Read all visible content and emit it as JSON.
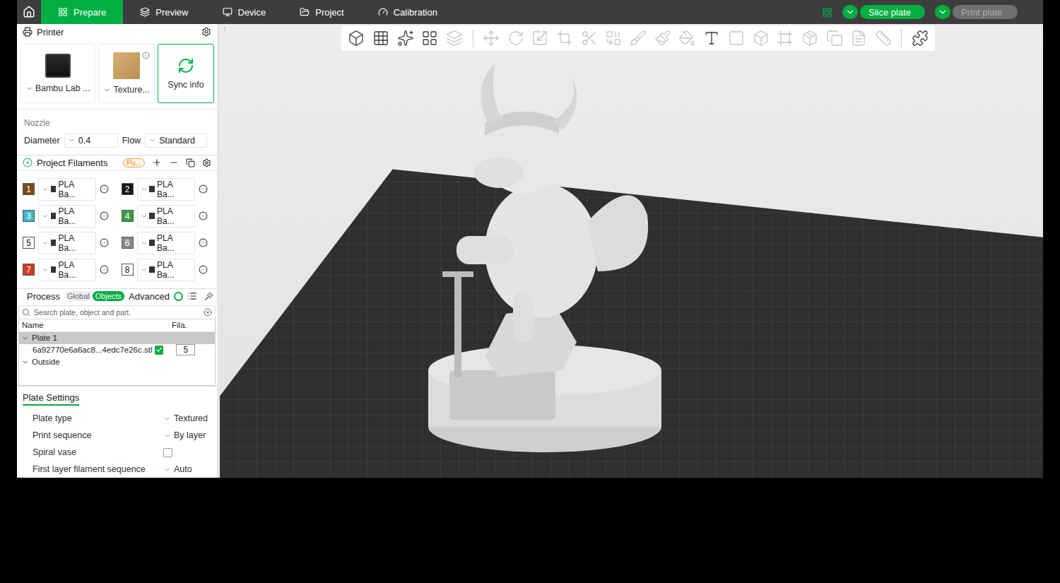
{
  "topbar": {
    "tabs": [
      {
        "label": "Prepare",
        "selected": true
      },
      {
        "label": "Preview",
        "selected": false
      },
      {
        "label": "Device",
        "selected": false
      },
      {
        "label": "Project",
        "selected": false
      },
      {
        "label": "Calibration",
        "selected": false
      }
    ],
    "slice_button": {
      "label": "Slice plate",
      "disabled": false
    },
    "print_button": {
      "label": "Print plate",
      "disabled": true
    }
  },
  "printer": {
    "title": "Printer",
    "cards": [
      {
        "label": "Bambu Lab ...",
        "kind": "printer",
        "selected": false
      },
      {
        "label": "Texture...",
        "kind": "plate",
        "selected": false
      },
      {
        "label": "Sync info",
        "kind": "sync",
        "selected": true
      }
    ]
  },
  "nozzle": {
    "title": "Nozzle",
    "fields": [
      {
        "label": "Diameter",
        "value": "0.4"
      },
      {
        "label": "Flow",
        "value": "Standard"
      }
    ]
  },
  "filaments": {
    "title": "Project Filaments",
    "badge": "Pu...",
    "items": [
      {
        "number": "1",
        "name": "PLA Ba...",
        "color": "#7a4a14"
      },
      {
        "number": "2",
        "name": "PLA Ba...",
        "color": "#151515"
      },
      {
        "number": "3",
        "name": "PLA Ba...",
        "color": "#3fb6c6"
      },
      {
        "number": "4",
        "name": "PLA Ba...",
        "color": "#3a9a48"
      },
      {
        "number": "5",
        "name": "PLA Ba...",
        "color": "#ffffff"
      },
      {
        "number": "6",
        "name": "PLA Ba...",
        "color": "#8a8a8a"
      },
      {
        "number": "7",
        "name": "PLA Ba...",
        "color": "#d13b1f"
      },
      {
        "number": "8",
        "name": "PLA Ba...",
        "color": "#ffffff"
      }
    ]
  },
  "process": {
    "title": "Process",
    "modes": [
      {
        "label": "Global",
        "selected": false
      },
      {
        "label": "Objects",
        "selected": true
      }
    ],
    "advanced": {
      "label": "Advanced",
      "on": true
    },
    "search": {
      "placeholder": "Search plate, object and part."
    },
    "columns": [
      "Name",
      "Fila."
    ],
    "tree": [
      {
        "kind": "plate",
        "name": "Plate 1",
        "expanded": true,
        "selected": true
      },
      {
        "kind": "object",
        "name": "6a92770e6a6ac8...4edc7e26c.stl",
        "checked": true,
        "filament": "5",
        "selected": false
      },
      {
        "kind": "group",
        "name": "Outside",
        "expanded": true,
        "selected": false
      }
    ]
  },
  "plate_settings": {
    "title": "Plate Settings",
    "rows": [
      {
        "label": "Plate type",
        "kind": "select",
        "value": "Textured"
      },
      {
        "label": "Print sequence",
        "kind": "select",
        "value": "By layer"
      },
      {
        "label": "Spiral vase",
        "kind": "checkbox",
        "checked": false
      },
      {
        "label": "First layer filament sequence",
        "kind": "select",
        "value": "Auto"
      }
    ]
  },
  "toolbar": {
    "groups": [
      [
        {
          "disabled": false
        },
        {
          "disabled": false
        },
        {
          "disabled": false
        },
        {
          "disabled": false
        },
        {
          "disabled": true
        }
      ],
      [
        {
          "disabled": true
        },
        {
          "disabled": true
        },
        {
          "disabled": true
        },
        {
          "disabled": true
        },
        {
          "disabled": true
        },
        {
          "disabled": true
        },
        {
          "disabled": true
        },
        {
          "disabled": true
        },
        {
          "disabled": true
        },
        {
          "disabled": false
        },
        {
          "disabled": true
        },
        {
          "disabled": true
        },
        {
          "disabled": true
        },
        {
          "disabled": true
        },
        {
          "disabled": true
        },
        {
          "disabled": true
        },
        {
          "disabled": true
        }
      ],
      [
        {
          "disabled": false
        }
      ]
    ]
  }
}
